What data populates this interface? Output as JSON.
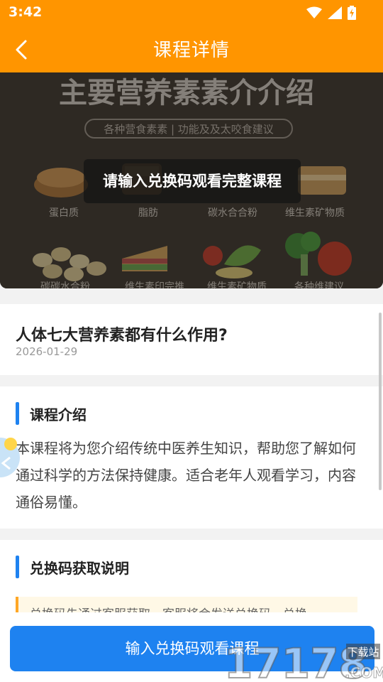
{
  "status_bar": {
    "time": "3:42",
    "icons": [
      "wifi-icon",
      "signal-icon",
      "battery-charging-icon"
    ]
  },
  "app_bar": {
    "back_icon": "back-chevron-icon",
    "title": "课程详情"
  },
  "hero": {
    "banner_title": "主要营养素素介介绍",
    "banner_subtitle": "各种营食素素 | 功能及及太咬食建议",
    "food_labels_row1": [
      "蛋白质",
      "脂肪",
      "碳水合合粉",
      "维生素矿物质"
    ],
    "food_labels_row2": [
      "碳碳水合粉",
      "维生素印完推",
      "维生素矿物质",
      "各种维建议"
    ],
    "locked_message": "请输入兑换码观看完整课程"
  },
  "course": {
    "title": "人体七大营养素都有什么作用?",
    "date": "2026-01-29"
  },
  "intro": {
    "heading": "课程介绍",
    "description": "本课程将为您介绍传统中医养生知识，帮助您了解如何通过科学的方法保持健康。适合老年人观看学习，内容通俗易懂。"
  },
  "redeem": {
    "heading": "兑换码获取说明",
    "notice": "兑换码先通过客服获取，客服将会发送兑换码，兑换"
  },
  "cta": {
    "label": "输入兑换码观看课程"
  },
  "watermark": {
    "text": "17178",
    "suffix": ".COM",
    "tag": "下载站"
  },
  "colors": {
    "header": "#ff9500",
    "accent": "#1e82f0",
    "notice_bg": "#fff8e6",
    "notice_border": "#ffa726"
  }
}
